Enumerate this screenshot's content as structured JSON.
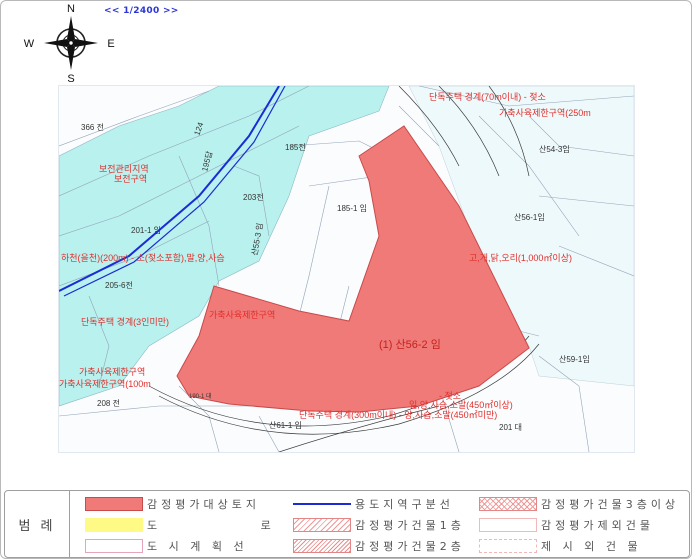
{
  "scale": "<< 1/2400 >>",
  "compass": {
    "n": "N",
    "s": "S",
    "e": "E",
    "w": "W"
  },
  "map": {
    "parcel_labels": [
      "366 전",
      "185전",
      "203전",
      "201-1 임",
      "205-6전",
      "208 전",
      "185-1 임",
      "산56-1임",
      "산54-3임",
      "산59-1임",
      "산61-1 임",
      "산55-3 임",
      "190-1 대",
      "201 대",
      "195답",
      "124"
    ],
    "subject_label": "(1) 산56-2 임",
    "zone_texts": [
      "단독주택 경계(70m이내) - 젖소",
      "가축사육제한구역(250m",
      "보전관리지역",
      "보전구역",
      "하천(을천)(200m) - 소(젖소포함),말,양,사슴",
      "가축사육제한구역",
      "고,개,닭,오리(1,000㎡이상)",
      "단독주택 경계(3인미만)",
      "가축사육제한구역",
      "가축사육제한구역(100m",
      "- 젖소",
      "일,양,사슴,소말(450㎡이상)",
      "단독주택 경계(300m이내) - 양,사슴,소말(450㎡미만)",
      "산57-1 임"
    ]
  },
  "legend": {
    "title": "범 례",
    "items": [
      {
        "label": "감정평가대상토지"
      },
      {
        "label": "용도지역구분선"
      },
      {
        "label": "감정평가건물3층이상"
      },
      {
        "label": "도 로"
      },
      {
        "label": "감정평가건물1층"
      },
      {
        "label": "감정평가제외건물"
      },
      {
        "label": "도 시 계 획 선"
      },
      {
        "label": "감정평가건물2층"
      },
      {
        "label": "제 시 외 건 물"
      }
    ]
  },
  "colors": {
    "subject": "#ef7a78",
    "zone": "#b9f2ef",
    "line": "#1b2bd6",
    "text": "#e0302d"
  }
}
